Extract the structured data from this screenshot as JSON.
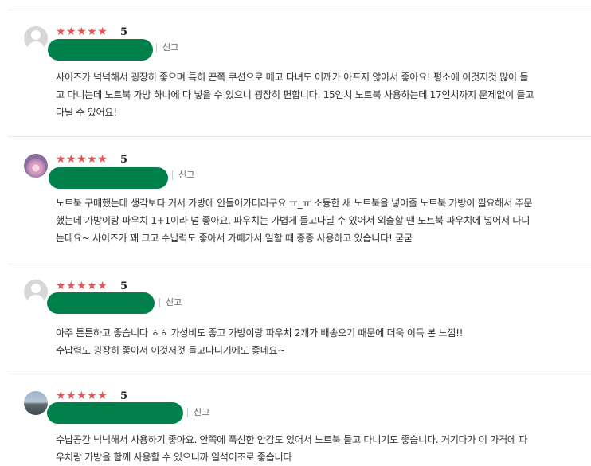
{
  "reviews": [
    {
      "avatar": "default-user-icon",
      "stars": "★★★★★",
      "rating": "5",
      "report_label": "신고",
      "content": "사이즈가 넉넉해서 굉장히 좋으며 특히 끈쪽 쿠션으로 메고 다녀도 어깨가 아프지 않아서 좋아요! 평소에 이것저것 많이 들\n고 다니는데 노트북 가방 하나에 다 넣을 수 있으니 굉장히 편합니다. 15인치 노트북 사용하는데 17인치까지 문제없이 들고\n다닐 수 있어요!"
    },
    {
      "avatar": "flower-photo-avatar",
      "stars": "★★★★★",
      "rating": "5",
      "report_label": "신고",
      "content": "노트북 구매했는데 생각보다 커서 가방에 안들어가더라구요 ㅠ_ㅠ 소듕한 새 노트북을 넣어줄 노트북 가방이 필요해서 주문\n했는데 가방이랑 파우치 1+1이라 넘 좋아요. 파우치는 가볍게 들고다닐 수 있어서 외출할 땐 노트북 파우치에 넣어서 다니\n는데요~ 사이즈가 꽤 크고 수납력도 좋아서 카페가서 일할 때 종종 사용하고 있습니다! 굳굳"
    },
    {
      "avatar": "default-user-icon",
      "stars": "★★★★★",
      "rating": "5",
      "report_label": "신고",
      "content": "아주 튼튼하고 좋습니다 ㅎㅎ 가성비도 좋고 가방이랑 파우치 2개가 배송오기 때문에 더욱 이득 본 느낌!!\n수납력도 굉장히 좋아서 이것저것 들고다니기에도 좋네요~"
    },
    {
      "avatar": "landscape-photo-avatar",
      "stars": "★★★★★",
      "rating": "5",
      "report_label": "신고",
      "content": "수납공간 넉넉해서 사용하기 좋아요. 안쪽에 푹신한 안감도 있어서 노트북 들고 다니기도 좋습니다. 거기다가 이 가격에 파\n우치랑 가방을 함께 사용할 수 있으니까 일석이조로 좋습니다"
    }
  ]
}
